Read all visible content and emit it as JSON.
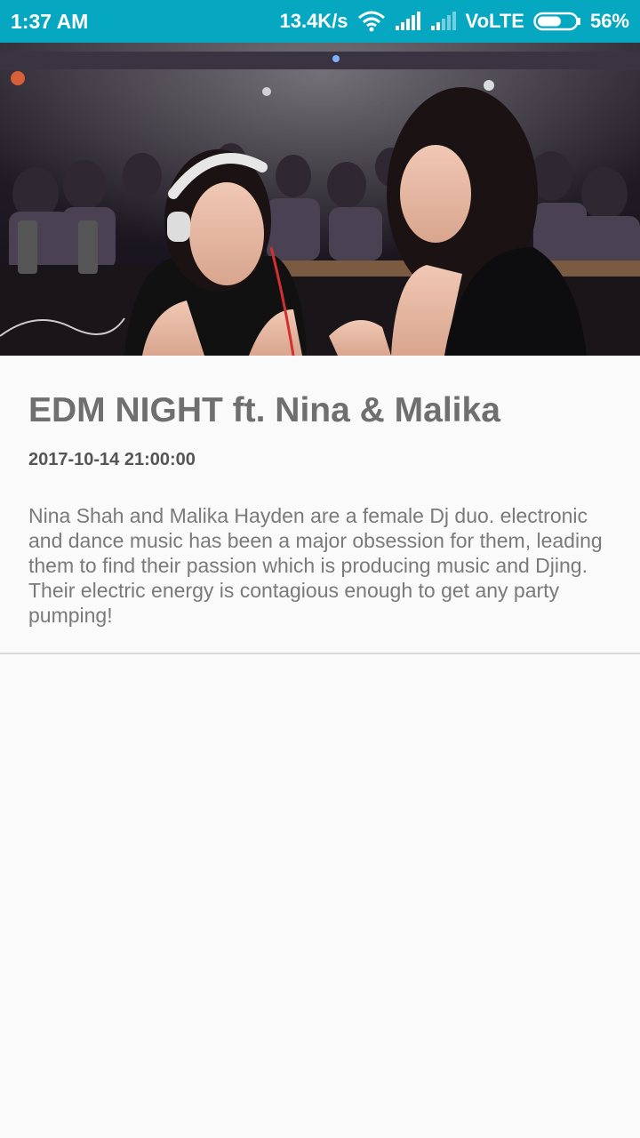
{
  "status_bar": {
    "time": "1:37 AM",
    "network_speed": "13.4K/s",
    "network_type": "VoLTE",
    "battery": "56%",
    "background_color": "#05a7c1"
  },
  "event": {
    "title": "EDM NIGHT ft. Nina & Malika",
    "datetime": "2017-10-14 21:00:00",
    "description": "Nina Shah and Malika Hayden are a female Dj duo. electronic and dance music has been a major obsession for them, leading them to find their passion which is producing music and Djing. Their electric energy is contagious enough to get any party pumping!"
  },
  "icons": {
    "wifi": "wifi-icon",
    "signal_1": "signal-icon",
    "signal_2": "signal-weak-icon",
    "battery": "battery-icon"
  }
}
